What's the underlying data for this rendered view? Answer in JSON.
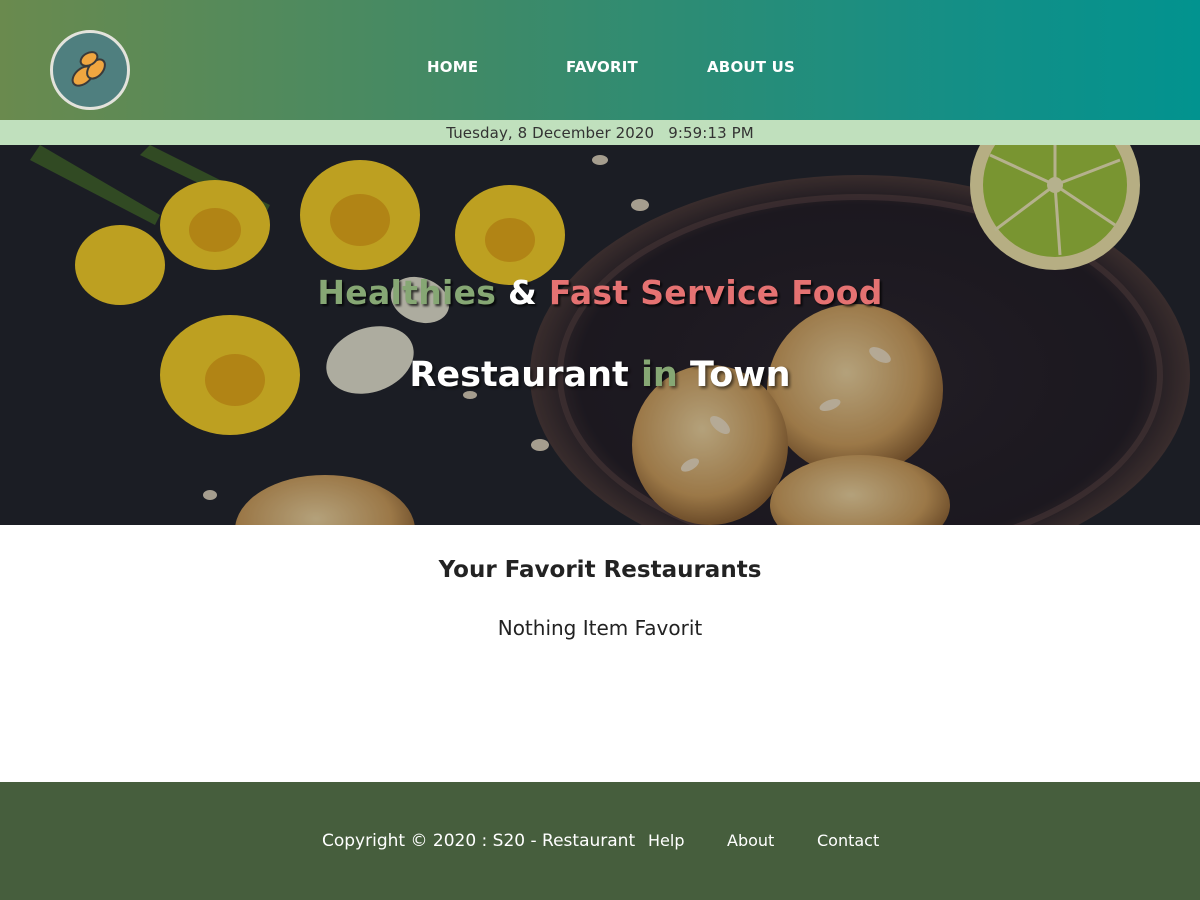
{
  "header": {
    "logo_icon": "almond-logo-icon",
    "nav": [
      {
        "label": "HOME"
      },
      {
        "label": "FAVORIT"
      },
      {
        "label": "ABOUT US"
      }
    ],
    "gradient_colors": [
      "#6a8a4e",
      "#02938f"
    ]
  },
  "date_bar": {
    "date": "Tuesday, 8 December 2020",
    "time": "9:59:13 PM",
    "background": "#c0e0bd"
  },
  "hero": {
    "line1": {
      "part1": "Healthies",
      "part2": "&",
      "part3": "Fast Service Food"
    },
    "line2": {
      "part1": "Restaurant",
      "part2": "in",
      "part3": "Town"
    },
    "accent_green": "#86a774",
    "accent_red": "#e57272"
  },
  "main": {
    "title": "Your Favorit Restaurants",
    "empty_message": "Nothing Item Favorit"
  },
  "footer": {
    "copyright": "Copyright © 2020 : S20 - Restaurant",
    "links": [
      {
        "label": "Help"
      },
      {
        "label": "About"
      },
      {
        "label": "Contact"
      }
    ],
    "background": "#465e3d"
  }
}
